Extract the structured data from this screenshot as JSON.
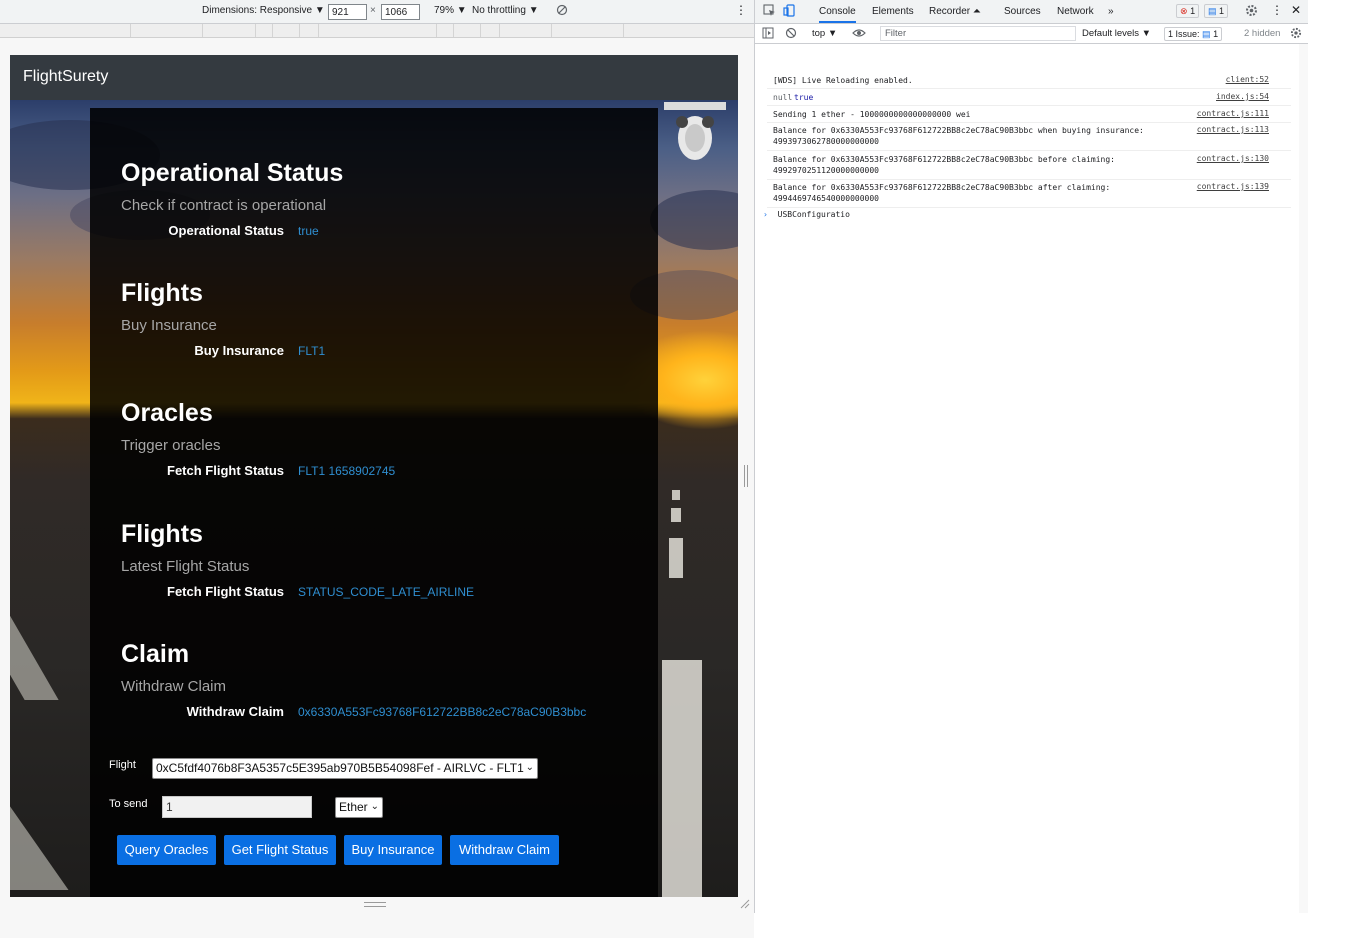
{
  "device_toolbar": {
    "dimensions_label": "Dimensions: Responsive ▼",
    "width_value": "921",
    "times": "×",
    "height_value": "1066",
    "zoom": "79% ▼",
    "throttling": "No throttling ▼",
    "more": "⋮"
  },
  "app": {
    "brand": "FlightSurety",
    "sections": [
      {
        "title": "Operational Status",
        "subtitle": "Check if contract is operational",
        "label": "Operational Status",
        "value": "true"
      },
      {
        "title": "Flights",
        "subtitle": "Buy Insurance",
        "label": "Buy Insurance",
        "value": "FLT1"
      },
      {
        "title": "Oracles",
        "subtitle": "Trigger oracles",
        "label": "Fetch Flight Status",
        "value": "FLT1 1658902745"
      },
      {
        "title": "Flights",
        "subtitle": "Latest Flight Status",
        "label": "Fetch Flight Status",
        "value": "STATUS_CODE_LATE_AIRLINE"
      },
      {
        "title": "Claim",
        "subtitle": "Withdraw Claim",
        "label": "Withdraw Claim",
        "value": "0x6330A553Fc93768F612722BB8c2eC78aC90B3bbc"
      }
    ],
    "form": {
      "flight_label": "Flight",
      "flight_selected": "0xC5fdf4076b8F3A5357c5E395ab970B5B54098Fef - AIRLVC - FLT1",
      "to_send_label": "To send",
      "to_send_value": "1",
      "unit_selected": "Ether"
    },
    "buttons": {
      "query_oracles": "Query Oracles",
      "get_flight_status": "Get Flight Status",
      "buy_insurance": "Buy Insurance",
      "withdraw_claim": "Withdraw Claim"
    }
  },
  "devtools": {
    "tabs": [
      "Console",
      "Elements",
      "Recorder ⏶",
      "Sources",
      "Network",
      "»"
    ],
    "error_count": "1",
    "message_count": "1",
    "context": "top ▼",
    "filter_placeholder": "Filter",
    "levels": "Default levels ▼",
    "issues": "1 Issue:",
    "issues_count": "1",
    "hidden": "2 hidden",
    "logs": [
      {
        "message": "[WDS] Live Reloading enabled.",
        "source": "client:52"
      },
      {
        "message": "null",
        "extra": "true",
        "source": "index.js:54"
      },
      {
        "message": "Sending 1 ether - 1000000000000000000 wei",
        "source": "contract.js:111"
      },
      {
        "message": "Balance for 0x6330A553Fc93768F612722BB8c2eC78aC90B3bbc when buying insurance:",
        "message2": "4993973062780000000000",
        "source": "contract.js:113"
      },
      {
        "message": "Balance for 0x6330A553Fc93768F612722BB8c2eC78aC90B3bbc before claiming:",
        "message2": "4992970251120000000000",
        "source": "contract.js:130"
      },
      {
        "message": "Balance for 0x6330A553Fc93768F612722BB8c2eC78aC90B3bbc after claiming:",
        "message2": "4994469746540000000000",
        "source": "contract.js:139"
      }
    ],
    "prompt_text": "USBConfiguratio"
  },
  "colors": {
    "navbar": "#343a40",
    "button": "#0a6fe3",
    "value_text": "#2f8ed0",
    "devtools_active_tab": "#1a73e8"
  }
}
